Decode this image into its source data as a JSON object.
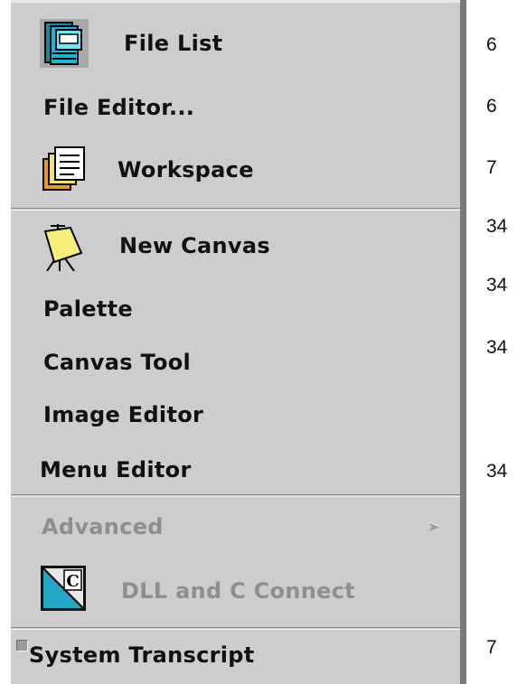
{
  "menu": {
    "items": [
      {
        "label": "File List",
        "icon": "file-list-icon",
        "enabled": true
      },
      {
        "label": "File Editor...",
        "enabled": true
      },
      {
        "label": "Workspace",
        "icon": "workspace-icon",
        "enabled": true
      },
      {
        "label": "New Canvas",
        "icon": "easel-icon",
        "enabled": true
      },
      {
        "label": "Palette",
        "enabled": true
      },
      {
        "label": "Canvas Tool",
        "enabled": true
      },
      {
        "label": "Image Editor",
        "enabled": true
      },
      {
        "label": "Menu Editor",
        "enabled": true
      },
      {
        "label": "Advanced",
        "enabled": false,
        "submenu": true
      },
      {
        "label": "DLL and C Connect",
        "icon": "c-connect-icon",
        "enabled": false
      },
      {
        "label": "System Transcript",
        "enabled": true,
        "checkbox": true
      }
    ]
  },
  "side_numbers": [
    "6",
    "6",
    "7",
    "34",
    "34",
    "34",
    "34",
    "7"
  ],
  "colors": {
    "menu_bg": "#cdcdcd",
    "text": "#111111",
    "disabled_text": "#8e8e8e",
    "shadow": "#7a7a7a"
  }
}
